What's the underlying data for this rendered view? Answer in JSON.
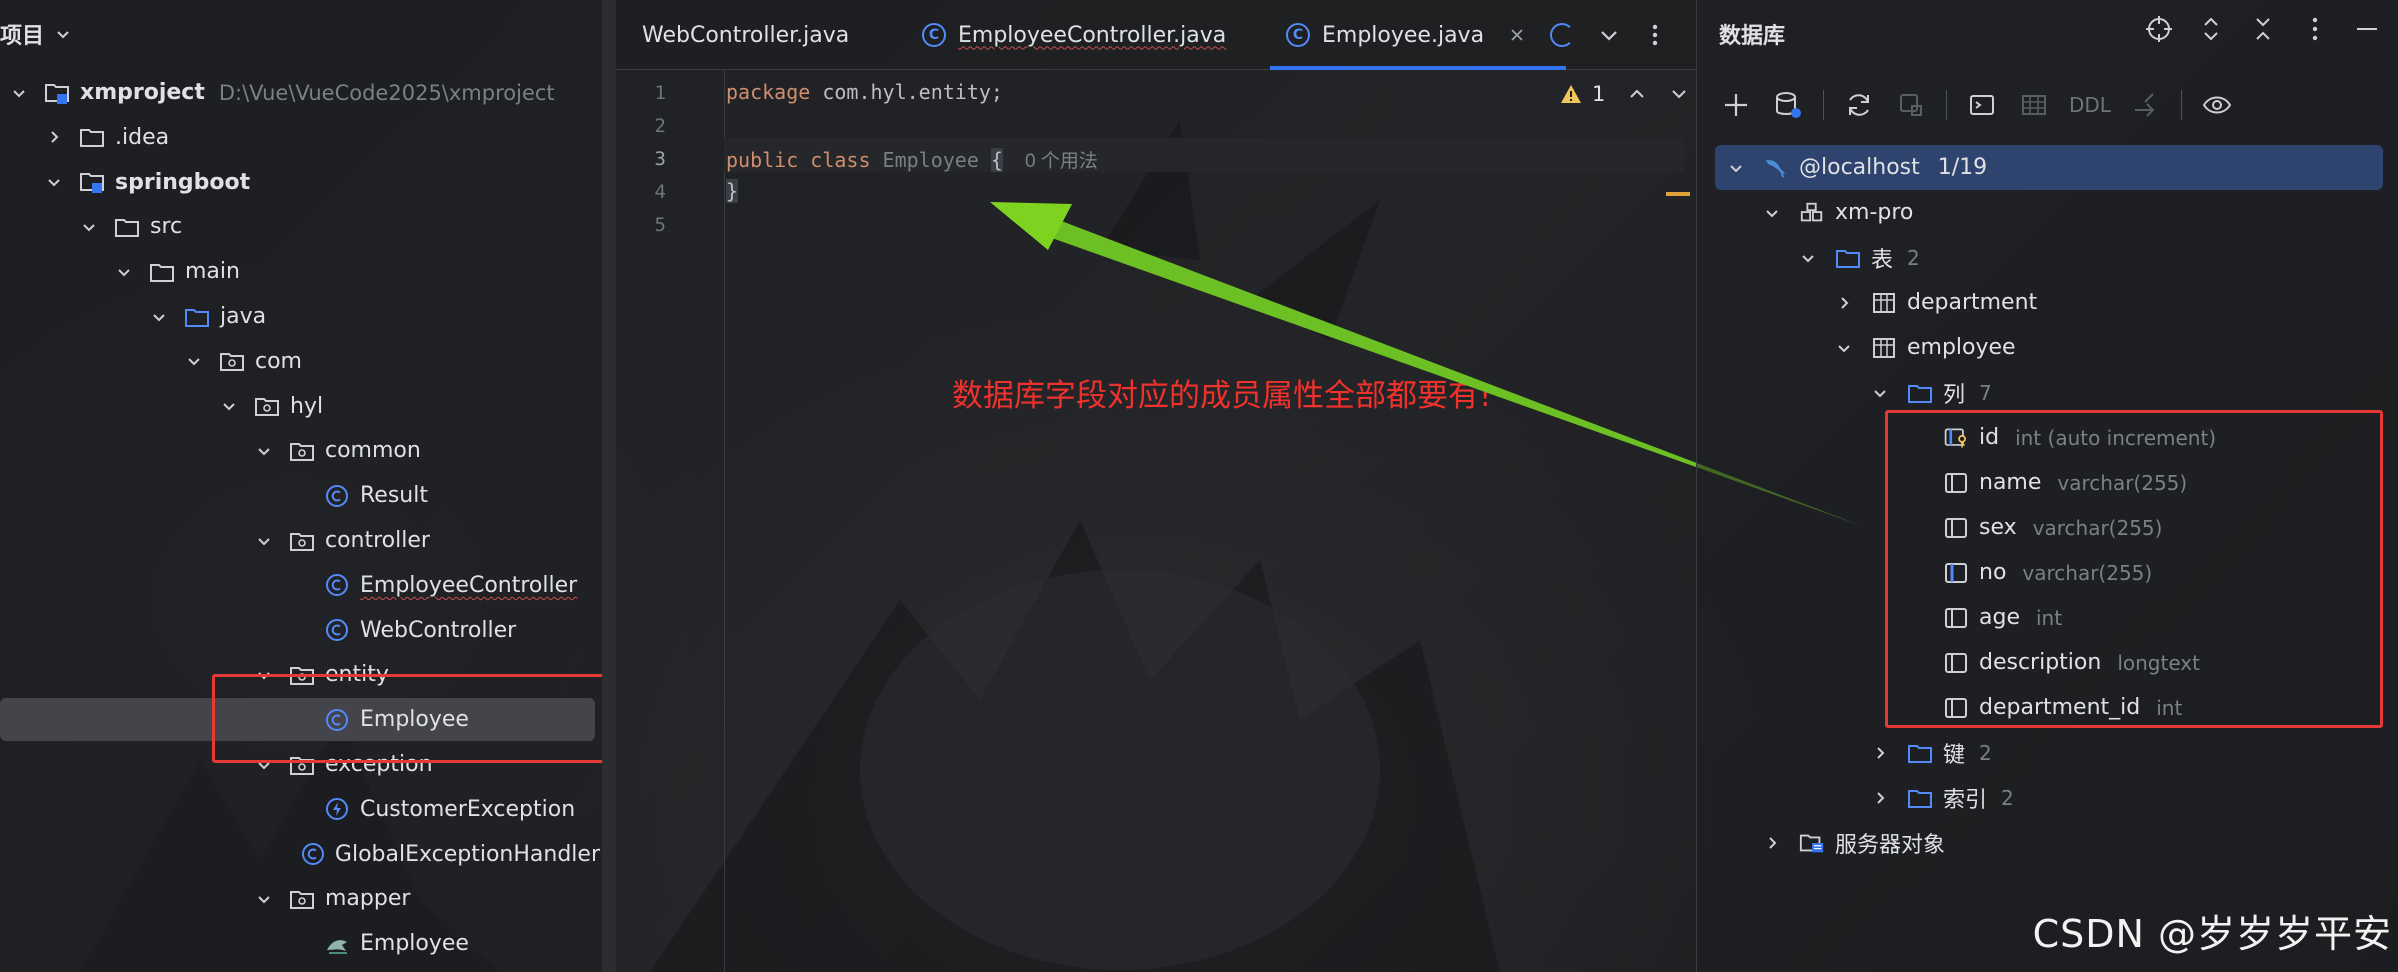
{
  "project": {
    "title": "项目",
    "tree": [
      {
        "label": "xmproject",
        "hint": "D:\\Vue\\VueCode2025\\xmproject",
        "icon": "module-folder-icon",
        "expanded": true
      },
      {
        "label": ".idea",
        "icon": "folder-icon",
        "expanded": false
      },
      {
        "label": "springboot",
        "icon": "module-folder-icon",
        "expanded": true
      },
      {
        "label": "src",
        "icon": "folder-icon",
        "expanded": true
      },
      {
        "label": "main",
        "icon": "folder-icon",
        "expanded": true
      },
      {
        "label": "java",
        "icon": "source-folder-icon",
        "expanded": true
      },
      {
        "label": "com",
        "icon": "package-icon",
        "expanded": true
      },
      {
        "label": "hyl",
        "icon": "package-icon",
        "expanded": true
      },
      {
        "label": "common",
        "icon": "package-icon",
        "expanded": true
      },
      {
        "label": "Result",
        "icon": "class-icon"
      },
      {
        "label": "controller",
        "icon": "package-icon",
        "expanded": true
      },
      {
        "label": "EmployeeController",
        "icon": "class-icon"
      },
      {
        "label": "WebController",
        "icon": "class-icon"
      },
      {
        "label": "entity",
        "icon": "package-icon",
        "expanded": true
      },
      {
        "label": "Employee",
        "icon": "class-icon",
        "selected": true
      },
      {
        "label": "exception",
        "icon": "package-icon",
        "expanded": true
      },
      {
        "label": "CustomerException",
        "icon": "exception-class-icon"
      },
      {
        "label": "GlobalExceptionHandler",
        "icon": "class-icon"
      },
      {
        "label": "mapper",
        "icon": "package-icon",
        "expanded": true
      },
      {
        "label": "Employee",
        "icon": "mybatis-mapper-icon"
      }
    ]
  },
  "editor": {
    "tabs": [
      {
        "label": "WebController.java",
        "icon": "class-icon"
      },
      {
        "label": "EmployeeController.java",
        "icon": "class-icon"
      },
      {
        "label": "Employee.java",
        "icon": "class-icon",
        "active": true
      }
    ],
    "line_numbers": [
      "1",
      "2",
      "3",
      "4",
      "5"
    ],
    "code": {
      "line1_kw": "package",
      "line1_rest": " com.hyl.entity;",
      "line3_kw": "public class",
      "line3_name": " Employee ",
      "line3_brace": "{",
      "line3_inlay": "0 个用法",
      "line4": "}"
    },
    "warning_count": "1",
    "annotation": "数据库字段对应的成员属性全部都要有!"
  },
  "database": {
    "title": "数据库",
    "toolbar_ddl": "DDL",
    "host": {
      "label": "@localhost",
      "count": "1/19"
    },
    "schema": "xm-pro",
    "tables_folder": {
      "label": "表",
      "count": "2"
    },
    "tables": [
      "department",
      "employee"
    ],
    "columns_folder": {
      "label": "列",
      "count": "7"
    },
    "columns": [
      {
        "name": "id",
        "type": "int (auto increment)",
        "icon": "primary-key-column-icon"
      },
      {
        "name": "name",
        "type": "varchar(255)",
        "icon": "column-icon"
      },
      {
        "name": "sex",
        "type": "varchar(255)",
        "icon": "column-icon"
      },
      {
        "name": "no",
        "type": "varchar(255)",
        "icon": "indexed-column-icon"
      },
      {
        "name": "age",
        "type": "int",
        "icon": "column-icon"
      },
      {
        "name": "description",
        "type": "longtext",
        "icon": "column-icon"
      },
      {
        "name": "department_id",
        "type": "int",
        "icon": "column-icon"
      }
    ],
    "keys_folder": {
      "label": "键",
      "count": "2"
    },
    "indexes_folder": {
      "label": "索引",
      "count": "2"
    },
    "server_objects": "服务器对象"
  },
  "watermark": "CSDN @岁岁岁平安",
  "colors": {
    "accent_blue": "#3574f0",
    "annotation_red": "#f0312c",
    "arrow_green": "#7ed321",
    "selection_host": "#2e436e"
  }
}
